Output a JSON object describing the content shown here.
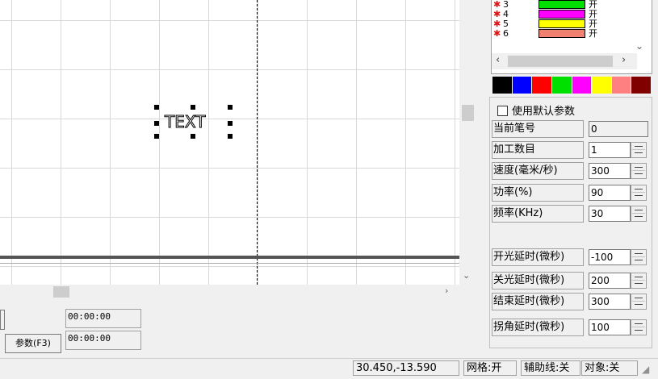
{
  "canvas": {
    "object_text": "TEXT"
  },
  "pens": [
    {
      "num": "3",
      "color": "#00e000",
      "state": "开"
    },
    {
      "num": "4",
      "color": "#ff00ff",
      "state": "开"
    },
    {
      "num": "5",
      "color": "#ffff00",
      "state": "开"
    },
    {
      "num": "6",
      "color": "#f08070",
      "state": "开"
    }
  ],
  "palette": [
    "#000000",
    "#0000ff",
    "#ff0000",
    "#00e000",
    "#ff00ff",
    "#ffff00",
    "#ff8080",
    "#800000"
  ],
  "params": {
    "use_default_label": "使用默认参数",
    "pen_no_label": "当前笔号",
    "pen_no_value": "0",
    "count_label": "加工数目",
    "count_value": "1",
    "speed_label": "速度(毫米/秒)",
    "speed_value": "300",
    "power_label": "功率(%)",
    "power_value": "90",
    "freq_label": "频率(KHz)",
    "freq_value": "30",
    "laser_on_delay_label": "开光延时(微秒)",
    "laser_on_delay_value": "-100",
    "laser_off_delay_label": "关光延时(微秒)",
    "laser_off_delay_value": "200",
    "end_delay_label": "结束延时(微秒)",
    "end_delay_value": "300",
    "corner_delay_label": "拐角延时(微秒)",
    "corner_delay_value": "100"
  },
  "bottom": {
    "params_button": "参数(F3)",
    "time1": "00:00:00",
    "time2": "00:00:00"
  },
  "status": {
    "coords": "30.450,-13.590",
    "grid": "网格:开",
    "guides": "辅助线:关",
    "object": "对象:关"
  }
}
